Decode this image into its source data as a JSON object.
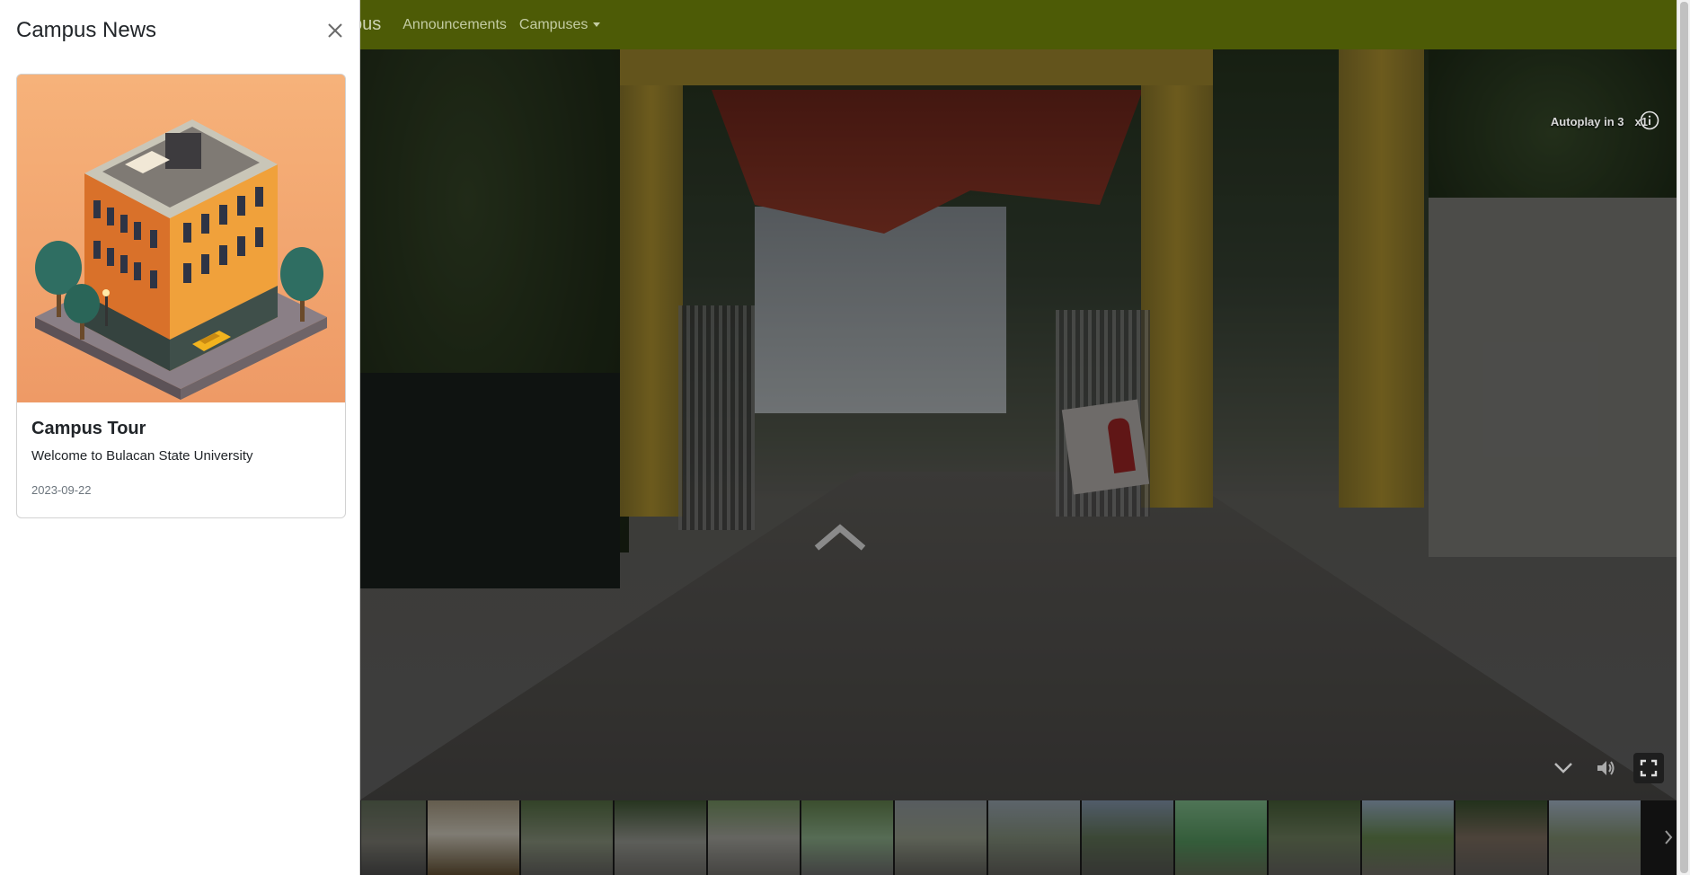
{
  "navbar": {
    "brand_fragment": "pus",
    "links": [
      "Announcements",
      "Campuses"
    ]
  },
  "viewer": {
    "autoplay_label": "Autoplay in 3",
    "speed_label": "x1",
    "icons": [
      "info-icon",
      "chevron-up-icon",
      "chevron-down-icon",
      "volume-icon",
      "fullscreen-icon",
      "chevron-right-icon"
    ],
    "thumbnail_count": 14
  },
  "offcanvas": {
    "title": "Campus News",
    "card": {
      "title": "Campus Tour",
      "text": "Welcome to Bulacan State University",
      "date": "2023-09-22"
    }
  },
  "colors": {
    "navbar": "#4d5b06",
    "panel": "#ffffff"
  }
}
